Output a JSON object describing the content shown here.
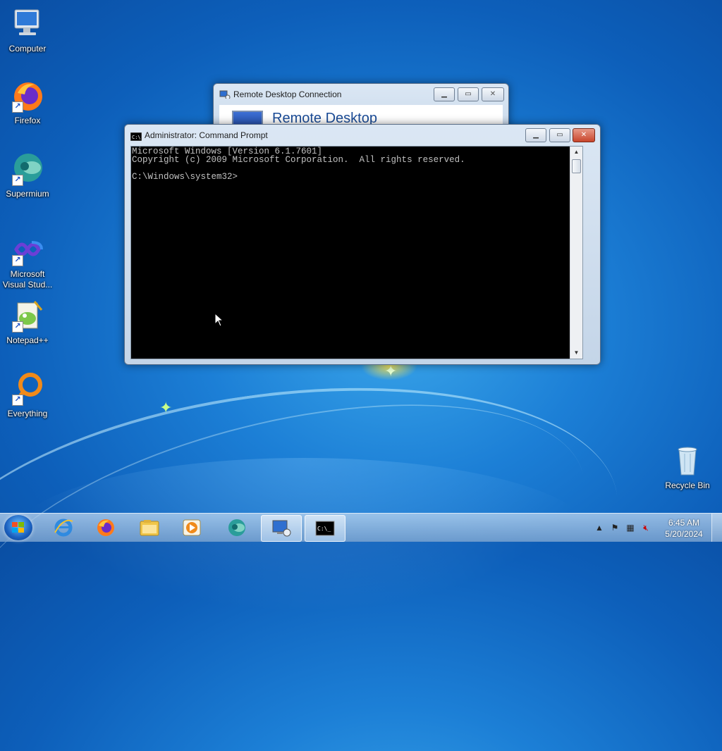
{
  "desktop": {
    "icons": [
      {
        "label": "Computer",
        "icon": "computer-icon"
      },
      {
        "label": "Firefox",
        "icon": "firefox-icon"
      },
      {
        "label": "Supermium",
        "icon": "supermium-icon"
      },
      {
        "label": "Microsoft\nVisual Stud...",
        "icon": "visual-studio-icon"
      },
      {
        "label": "Notepad++",
        "icon": "notepadpp-icon"
      },
      {
        "label": "Everything",
        "icon": "everything-icon"
      },
      {
        "label": "Recycle Bin",
        "icon": "recycle-bin-icon"
      }
    ]
  },
  "rdp_window": {
    "title": "Remote Desktop Connection",
    "heading": "Remote Desktop"
  },
  "cmd_window": {
    "title": "Administrator: Command Prompt",
    "lines": [
      "Microsoft Windows [Version 6.1.7601]",
      "Copyright (c) 2009 Microsoft Corporation.  All rights reserved.",
      "",
      "C:\\Windows\\system32>"
    ]
  },
  "taskbar": {
    "buttons": [
      {
        "icon": "internet-explorer-icon"
      },
      {
        "icon": "firefox-icon"
      },
      {
        "icon": "file-explorer-icon"
      },
      {
        "icon": "media-player-icon"
      },
      {
        "icon": "supermium-icon"
      },
      {
        "icon": "remote-desktop-icon",
        "active": true
      },
      {
        "icon": "command-prompt-icon",
        "active": true
      }
    ],
    "clock": {
      "time": "6:45 AM",
      "date": "5/20/2024"
    }
  },
  "colors": {
    "console_bg": "#000000",
    "console_fg": "#c0c0c0",
    "close_button": "#c8452c"
  }
}
